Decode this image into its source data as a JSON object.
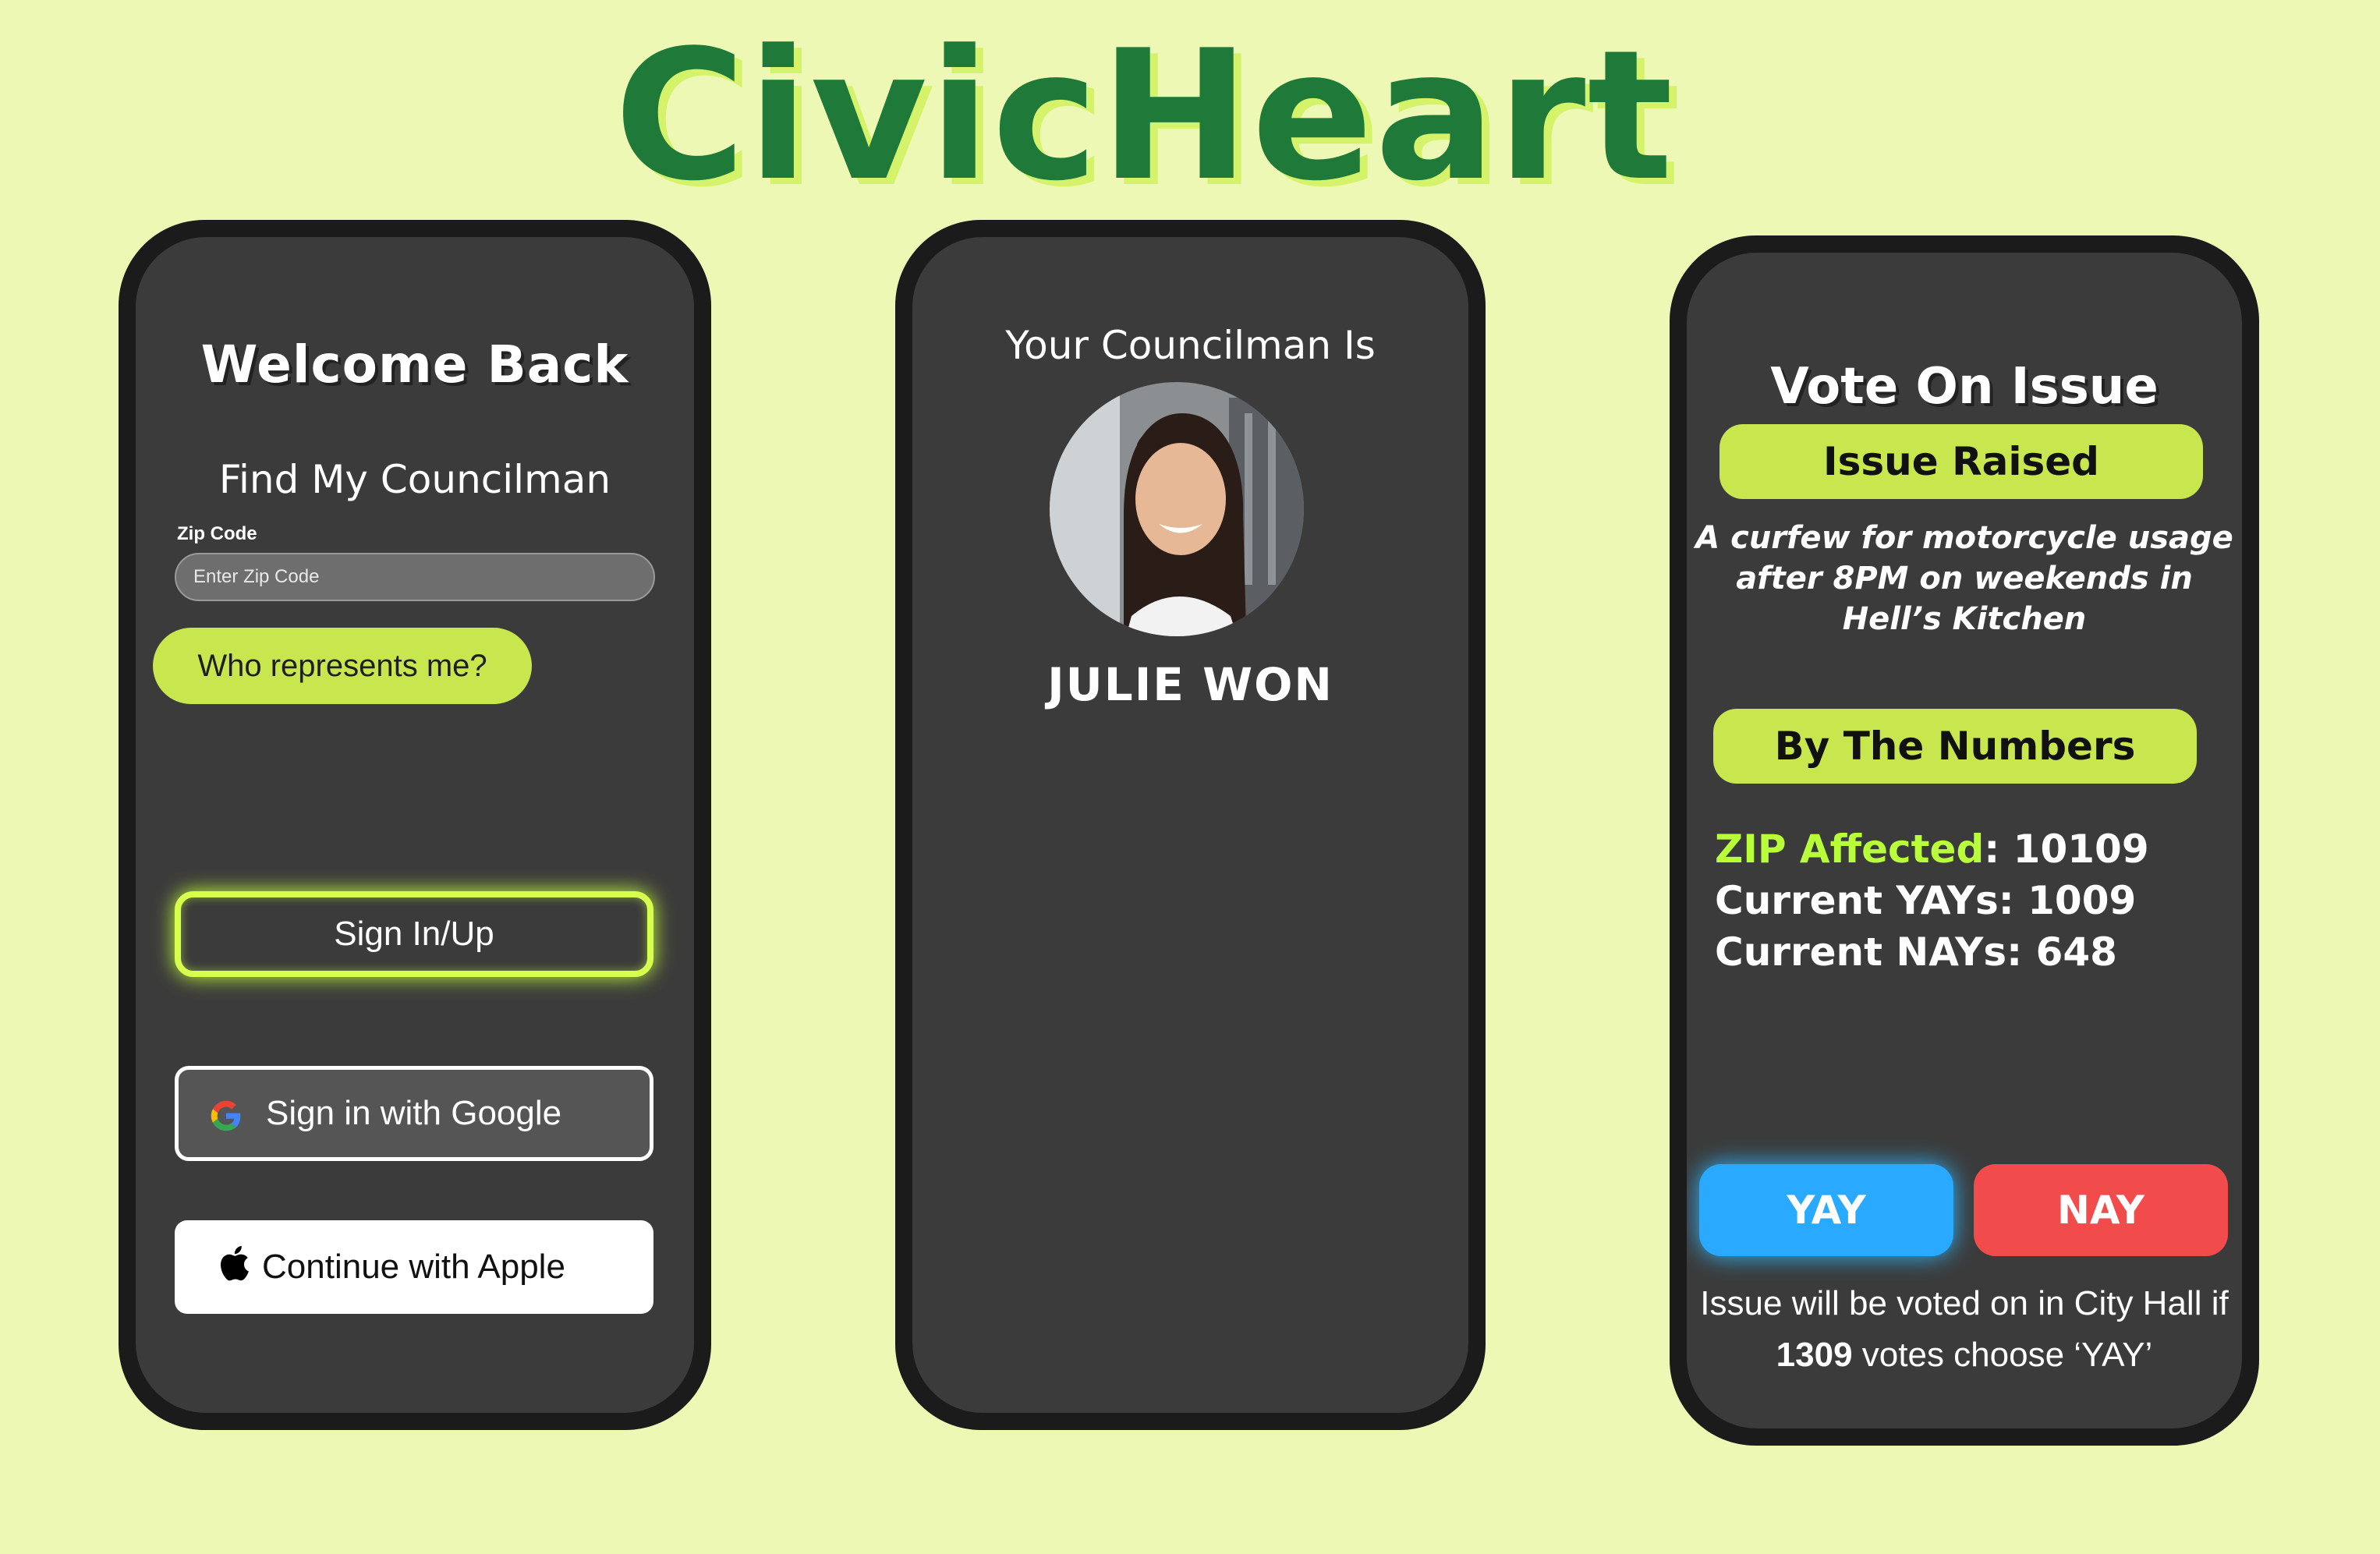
{
  "app": {
    "title": "CivicHeart"
  },
  "screen1": {
    "title": "Welcome Back",
    "subtitle": "Find My Councilman",
    "zip_label": "Zip Code",
    "zip_placeholder": "Enter Zip Code",
    "zip_value": "",
    "who_button": "Who represents me?",
    "signin_button": "Sign In/Up",
    "google_button": "Sign in with Google",
    "apple_button": "Continue with Apple",
    "accent_color": "#c8e64e"
  },
  "screen2": {
    "title": "Your Councilman Is",
    "name": "JULIE WON"
  },
  "screen3": {
    "title": "Vote On Issue",
    "issue_pill": "Issue Raised",
    "issue_text": "A curfew for motorcycle usage after 8PM on weekends in Hell’s Kitchen",
    "numbers_pill": "By The Numbers",
    "zip_label": "ZIP Affected",
    "zip_value": "10109",
    "yays_label": "Current YAYs",
    "yays_value": "1009",
    "nays_label": "Current NAYs",
    "nays_value": "648",
    "yay_button": "YAY",
    "nay_button": "NAY",
    "note_prefix": "Issue will be voted on in City Hall if ",
    "note_count": "1309",
    "note_suffix": " votes choose ‘YAY’",
    "yay_color": "#29a9ff",
    "nay_color": "#f24b4b"
  }
}
